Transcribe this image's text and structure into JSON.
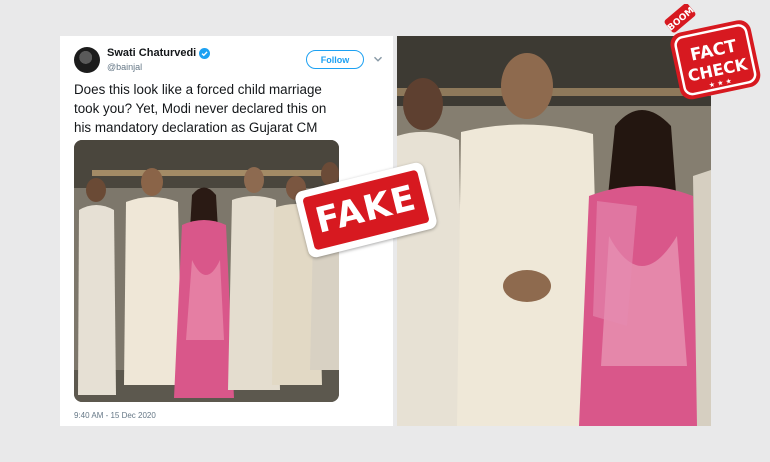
{
  "tweet": {
    "author_name": "Swati Chaturvedi",
    "author_handle": "@bainjal",
    "follow_label": "Follow",
    "text_lines": [
      "Does this look like a forced child marriage",
      "took you? Yet, Modi never declared this on",
      "his mandatory declaration as Gujarat CM"
    ],
    "timestamp": "9:40 AM - 15 Dec 2020"
  },
  "stamp": {
    "label": "FAKE",
    "color": "#d71920"
  },
  "logo": {
    "brand": "BOOM",
    "line1": "FACT",
    "line2": "CHECK",
    "color": "#d71920"
  },
  "colors": {
    "background": "#e9e9ea",
    "twitter_blue": "#1da1f2",
    "sari_pink": "#d9578a",
    "kurta_cream": "#ece3d2"
  },
  "icons": [
    "verified-icon",
    "chevron-down-icon"
  ]
}
